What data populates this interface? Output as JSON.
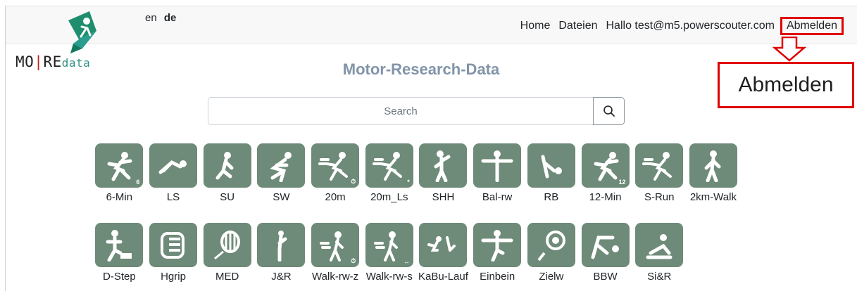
{
  "header": {
    "languages": {
      "en": "en",
      "de": "de"
    },
    "nav": {
      "home": "Home",
      "files": "Dateien",
      "greeting": "Hallo test@m5.powerscouter.com",
      "logout": "Abmelden"
    },
    "logo": {
      "part1": "MO",
      "part2": "RE",
      "part3": "data"
    }
  },
  "callout": {
    "zoom_label": "Abmelden",
    "accent_color": "#e00000"
  },
  "main": {
    "title": "Motor-Research-Data",
    "search": {
      "placeholder": "Search"
    },
    "tile_color": "#6e8a78",
    "row1": [
      {
        "label": "6-Min",
        "badge": "6"
      },
      {
        "label": "LS",
        "badge": ""
      },
      {
        "label": "SU",
        "badge": ""
      },
      {
        "label": "SW",
        "badge": ""
      },
      {
        "label": "20m",
        "badge": "⏱"
      },
      {
        "label": "20m_Ls",
        "badge": "*"
      },
      {
        "label": "SHH",
        "badge": ""
      },
      {
        "label": "Bal-rw",
        "badge": ""
      },
      {
        "label": "RB",
        "badge": ""
      },
      {
        "label": "12-Min",
        "badge": "12"
      },
      {
        "label": "S-Run",
        "badge": ""
      },
      {
        "label": "2km-Walk",
        "badge": ""
      }
    ],
    "row2": [
      {
        "label": "D-Step",
        "badge": ""
      },
      {
        "label": "Hgrip",
        "badge": ""
      },
      {
        "label": "MED",
        "badge": ""
      },
      {
        "label": "J&R",
        "badge": ""
      },
      {
        "label": "Walk-rw-z",
        "badge": "⏱"
      },
      {
        "label": "Walk-rw-s",
        "badge": "↔"
      },
      {
        "label": "KaBu-Lauf",
        "badge": ""
      },
      {
        "label": "Einbein",
        "badge": ""
      },
      {
        "label": "Zielw",
        "badge": ""
      },
      {
        "label": "BBW",
        "badge": ""
      },
      {
        "label": "Si&R",
        "badge": ""
      }
    ]
  }
}
